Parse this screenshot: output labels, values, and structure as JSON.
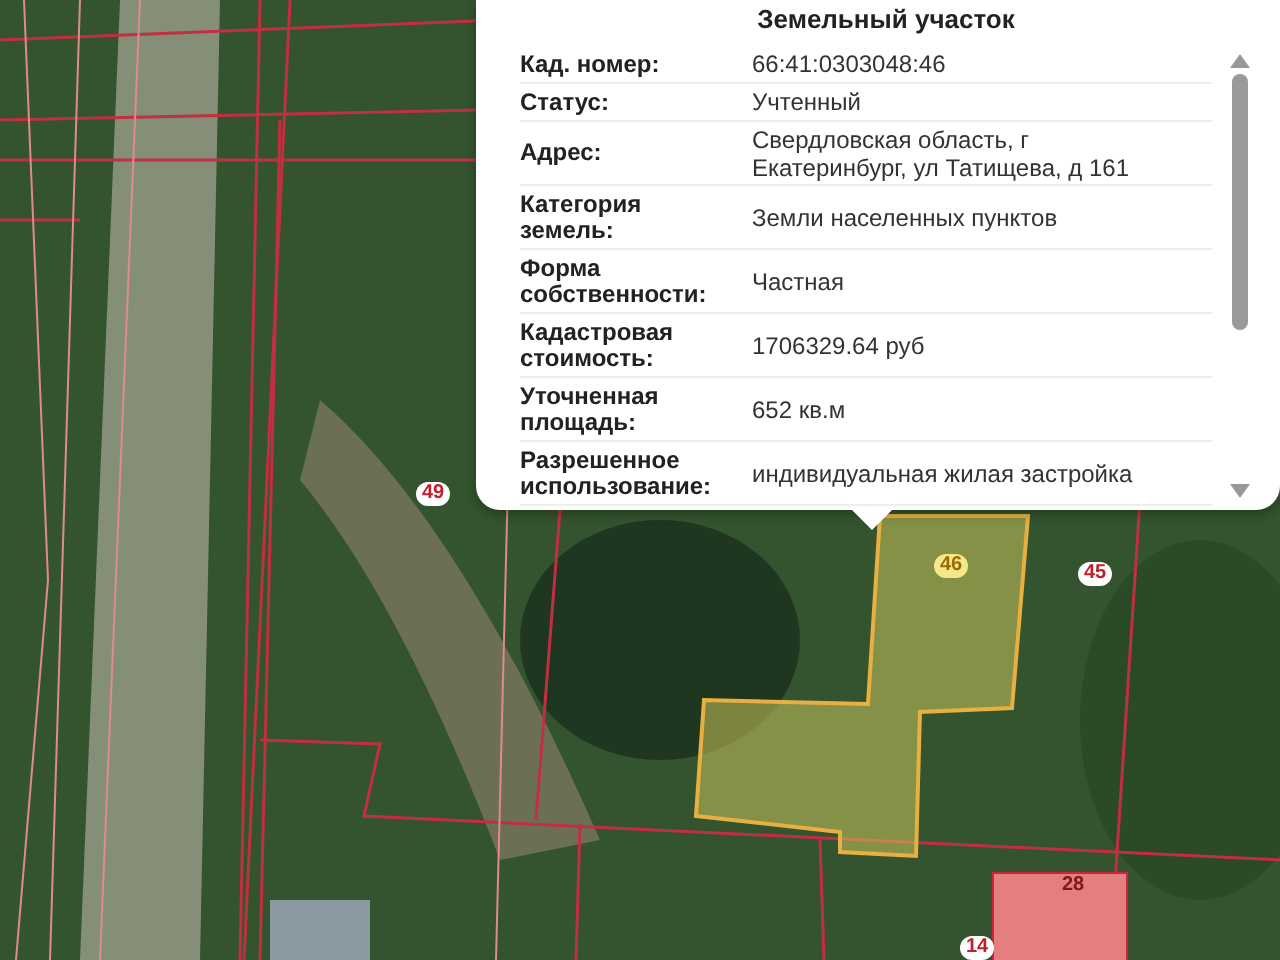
{
  "popup": {
    "title": "Земельный участок",
    "rows": [
      {
        "label": "Кад. номер:",
        "value": "66:41:0303048:46"
      },
      {
        "label": "Статус:",
        "value": "Учтенный"
      },
      {
        "label": "Адрес:",
        "value": "Свердловская область, г Екатеринбург, ул Татищева, д 161"
      },
      {
        "label": "Категория земель:",
        "value": "Земли населенных пунктов"
      },
      {
        "label": "Форма собственности:",
        "value": "Частная"
      },
      {
        "label": "Кадастровая стоимость:",
        "value": "1706329.64 руб"
      },
      {
        "label": "Уточненная площадь:",
        "value": "652 кв.м"
      },
      {
        "label": "Разрешенное использование:",
        "value": "индивидуальная жилая застройка"
      }
    ]
  },
  "map_labels": [
    {
      "text": "49",
      "kind": "plot",
      "selected": false
    },
    {
      "text": "46",
      "kind": "plot",
      "selected": true
    },
    {
      "text": "45",
      "kind": "plot",
      "selected": false
    },
    {
      "text": "28",
      "kind": "building",
      "selected": false
    },
    {
      "text": "14",
      "kind": "plot",
      "selected": false
    }
  ]
}
